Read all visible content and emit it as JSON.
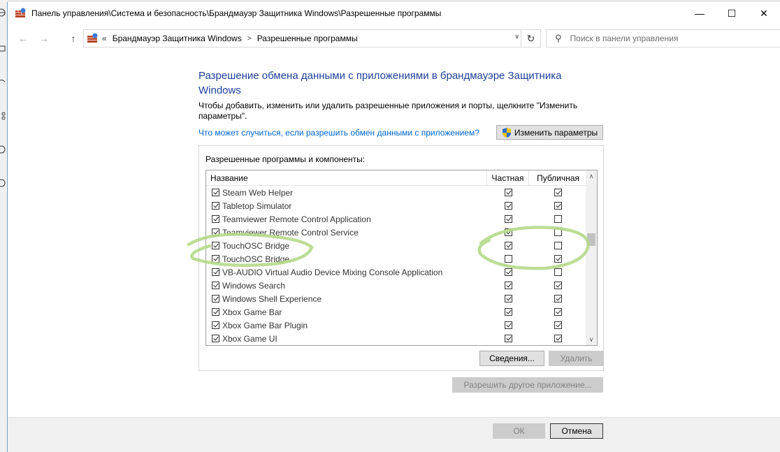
{
  "window": {
    "title": "Панель управления\\Система и безопасность\\Брандмауэр Защитника Windows\\Разрешенные программы",
    "minimize_glyph": "—",
    "maximize_glyph": "☐",
    "close_glyph": "✕"
  },
  "nav": {
    "back_glyph": "←",
    "forward_glyph": "→",
    "up_glyph": "↑",
    "address_prefix": "«",
    "crumbs": [
      "Брандмауэр Защитника Windows",
      "Разрешенные программы"
    ],
    "crumb_separator": ">",
    "dropdown_glyph": "∨",
    "refresh_glyph": "↻",
    "search_placeholder": "Поиск в панели управления",
    "search_glyph": "⚲"
  },
  "main": {
    "heading": "Разрешение обмена данными с приложениями в брандмауэре Защитника Windows",
    "description": "Чтобы добавить, изменить или удалить разрешенные приложения и порты, щелкните \"Изменить параметры\".",
    "help_link": "Что может случиться, если разрешить обмен данными с приложением?",
    "change_settings_label": "Изменить параметры",
    "group_label": "Разрешенные программы и компоненты:",
    "columns": {
      "name": "Название",
      "private": "Частная",
      "public": "Публичная"
    },
    "rows": [
      {
        "name": "Steam Web Helper",
        "enabled": true,
        "private": true,
        "public": true
      },
      {
        "name": "Tabletop Simulator",
        "enabled": true,
        "private": true,
        "public": true
      },
      {
        "name": "Teamviewer Remote Control Application",
        "enabled": true,
        "private": true,
        "public": false
      },
      {
        "name": "Teamviewer Remote Control Service",
        "enabled": true,
        "private": true,
        "public": false
      },
      {
        "name": "TouchOSC Bridge",
        "enabled": true,
        "private": true,
        "public": false
      },
      {
        "name": "TouchOSC Bridge",
        "enabled": true,
        "private": false,
        "public": true
      },
      {
        "name": "VB-AUDIO Virtual Audio Device Mixing Console Application",
        "enabled": true,
        "private": true,
        "public": false
      },
      {
        "name": "Windows Search",
        "enabled": true,
        "private": true,
        "public": true
      },
      {
        "name": "Windows Shell Experience",
        "enabled": true,
        "private": true,
        "public": true
      },
      {
        "name": "Xbox Game Bar",
        "enabled": true,
        "private": true,
        "public": true
      },
      {
        "name": "Xbox Game Bar Plugin",
        "enabled": true,
        "private": true,
        "public": true
      },
      {
        "name": "Xbox Game UI",
        "enabled": true,
        "private": true,
        "public": true
      }
    ],
    "scroll_up_glyph": "∧",
    "scroll_down_glyph": "∨",
    "details_label": "Сведения...",
    "remove_label": "Удалить",
    "allow_other_label": "Разрешить другое приложение..."
  },
  "footer": {
    "ok_label": "ОК",
    "cancel_label": "Отмена"
  },
  "colors": {
    "heading": "#1e3f99",
    "link": "#0066cc",
    "scribble": "#b5d98a",
    "footer_bg": "#f0f0f0"
  }
}
